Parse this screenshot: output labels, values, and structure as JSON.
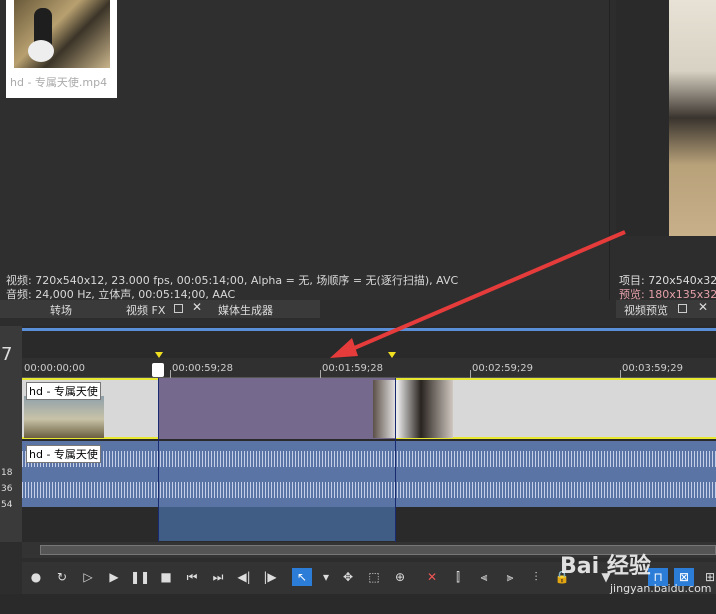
{
  "media": {
    "file_name": "hd - 专属天使.mp4",
    "info_video": "视频: 720x540x12, 23.000 fps, 00:05:14;00, Alpha = 无, 场顺序 = 无(逐行扫描), AVC",
    "info_audio": "音频: 24,000 Hz, 立体声, 00:05:14;00, AAC"
  },
  "left_tabs": [
    "转场",
    "视频 FX",
    "媒体生成器"
  ],
  "preview": {
    "project_line": "项目: 720x540x32",
    "preview_line": "预览: 180x135x32",
    "tab": "视频预览"
  },
  "timeline": {
    "track_number": "7",
    "ruler_ticks": [
      "00:00:00;00",
      "00:00:59;28",
      "00:01:59;28",
      "00:02:59;29",
      "00:03:59;29"
    ],
    "video_clip_label": "hd - 专属天使",
    "audio_clip_label": "hd - 专属天使",
    "db_labels": [
      "18",
      "36",
      "54"
    ]
  },
  "toolbar": {
    "icons": [
      "record-icon",
      "loop-icon",
      "play-from-start-icon",
      "play-icon",
      "pause-icon",
      "stop-icon",
      "prev-marker-icon",
      "next-marker-icon",
      "prev-frame-icon",
      "next-frame-icon",
      "normal-edit-tool-icon",
      "dropdown-icon",
      "envelope-tool-icon",
      "selection-tool-icon",
      "zoom-tool-icon",
      "delete-icon",
      "trim-icon",
      "trim-start-icon",
      "trim-end-icon",
      "split-icon",
      "lock-icon",
      "marker-icon",
      "region-icon",
      "snap-icon",
      "auto-ripple-icon"
    ]
  },
  "colors": {
    "accent": "#2b7dd8",
    "selection": "#756a8e",
    "audio": "#5a74a6",
    "arrow": "#e53b3b"
  },
  "watermark": {
    "brand": "Bai 经验",
    "site": "jingyan.baidu.com"
  }
}
